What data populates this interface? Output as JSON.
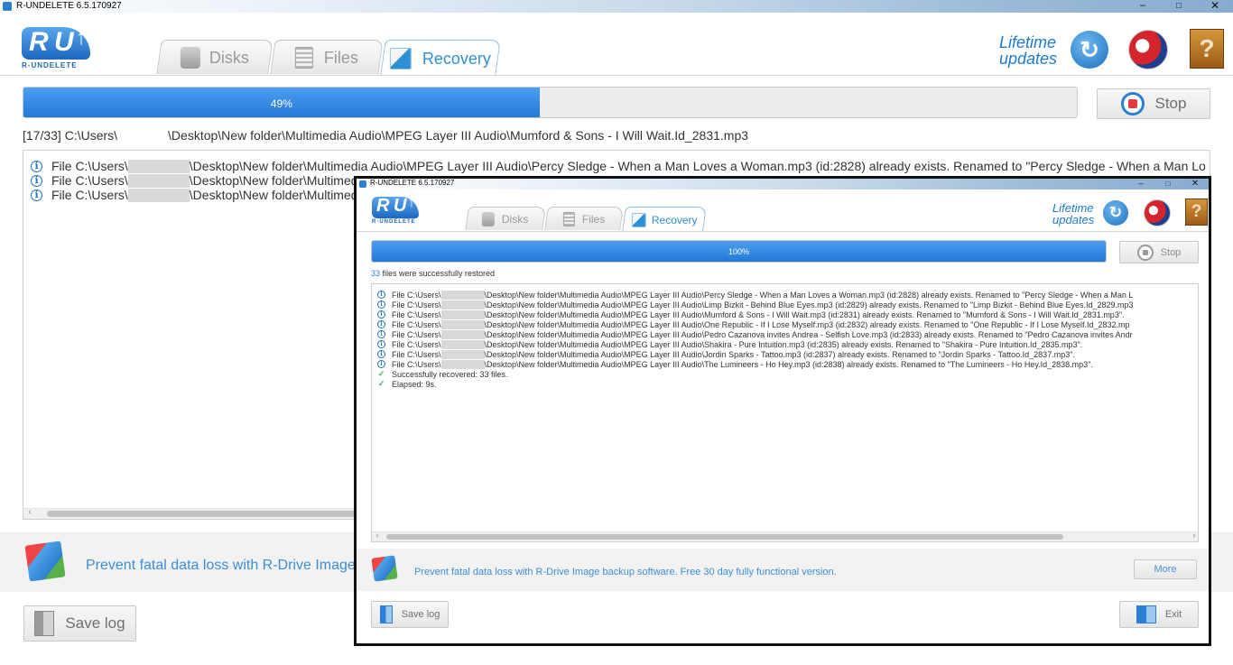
{
  "colors": {
    "accent": "#2478d9",
    "link": "#3a8fd6",
    "ok": "#4caf50",
    "stop": "#e23b3b"
  },
  "main_window": {
    "title": "R-UNDELETE 6.5.170927",
    "logo_text": "R-UNDELETE",
    "tabs": [
      {
        "label": "Disks",
        "icon": "disk-icon"
      },
      {
        "label": "Files",
        "icon": "files-icon"
      },
      {
        "label": "Recovery",
        "icon": "recovery-icon"
      }
    ],
    "lifetime_line1": "Lifetime",
    "lifetime_line2": "updates",
    "progress_percent": 49,
    "progress_label": "49%",
    "stop_label": "Stop",
    "current_file": "[17/33] C:\\Users\\    \\Desktop\\New folder\\Multimedia Audio\\MPEG Layer III Audio\\Mumford & Sons - I Will Wait.Id_2831.mp3",
    "log": [
      {
        "pre": "File C:\\Users\\",
        "post": "\\Desktop\\New folder\\Multimedia Audio\\MPEG Layer III Audio\\Percy Sledge - When a Man Loves a Woman.mp3 (id:2828) already exists. Renamed to \"Percy Sledge - When a Man Lo"
      },
      {
        "pre": "File C:\\Users\\",
        "post": "\\Desktop\\New folder\\Multimed"
      },
      {
        "pre": "File C:\\Users\\",
        "post": "\\Desktop\\New folder\\Multimed"
      }
    ],
    "promo": "Prevent fatal data loss with R-Drive Image",
    "save_log_label": "Save log"
  },
  "dialog_window": {
    "title": "R-UNDELETE 6.5.170927",
    "logo_text": "R-UNDELETE",
    "tabs": [
      {
        "label": "Disks",
        "icon": "disk-icon"
      },
      {
        "label": "Files",
        "icon": "files-icon"
      },
      {
        "label": "Recovery",
        "icon": "recovery-icon"
      }
    ],
    "lifetime_line1": "Lifetime",
    "lifetime_line2": "updates",
    "progress_percent": 100,
    "progress_label": "100%",
    "stop_label": "Stop",
    "restored_count": "33",
    "restored_text": " files were successfully restored",
    "log": [
      {
        "pre": "File C:\\Users\\",
        "post": "\\Desktop\\New folder\\Multimedia Audio\\MPEG Layer III Audio\\Percy Sledge - When a Man Loves a Woman.mp3 (id:2828) already exists. Renamed to \"Percy Sledge - When a Man L"
      },
      {
        "pre": "File C:\\Users\\",
        "post": "\\Desktop\\New folder\\Multimedia Audio\\MPEG Layer III Audio\\Limp Bizkit - Behind Blue Eyes.mp3 (id:2829) already exists. Renamed to \"Limp Bizkit - Behind Blue Eyes.Id_2829.mp3"
      },
      {
        "pre": "File C:\\Users\\",
        "post": "\\Desktop\\New folder\\Multimedia Audio\\MPEG Layer III Audio\\Mumford & Sons - I Will Wait.mp3 (id:2831) already exists. Renamed to \"Mumford & Sons - I Will Wait.Id_2831.mp3\"."
      },
      {
        "pre": "File C:\\Users\\",
        "post": "\\Desktop\\New folder\\Multimedia Audio\\MPEG Layer III Audio\\One Republic - If I Lose Myself.mp3 (id:2832) already exists. Renamed to \"One Republic - If I Lose Myself.Id_2832.mp"
      },
      {
        "pre": "File C:\\Users\\",
        "post": "\\Desktop\\New folder\\Multimedia Audio\\MPEG Layer III Audio\\Pedro Cazanova invites Andrea - Selfish Love.mp3 (id:2833) already exists. Renamed to \"Pedro Cazanova invites Andr"
      },
      {
        "pre": "File C:\\Users\\",
        "post": "\\Desktop\\New folder\\Multimedia Audio\\MPEG Layer III Audio\\Shakira - Pure Intuition.mp3 (id:2835) already exists. Renamed to \"Shakira - Pure Intuition.Id_2835.mp3\"."
      },
      {
        "pre": "File C:\\Users\\",
        "post": "\\Desktop\\New folder\\Multimedia Audio\\MPEG Layer III Audio\\Jordin Sparks - Tattoo.mp3 (id:2837) already exists. Renamed to \"Jordin Sparks - Tattoo.Id_2837.mp3\"."
      },
      {
        "pre": "File C:\\Users\\",
        "post": "\\Desktop\\New folder\\Multimedia Audio\\MPEG Layer III Audio\\The Lumineers - Ho Hey.mp3 (id:2838) already exists. Renamed to \"The Lumineers - Ho Hey.Id_2838.mp3\"."
      }
    ],
    "ok_lines": [
      "Successfully recovered: 33 files.",
      "Elapsed: 9s."
    ],
    "promo": "Prevent fatal data loss with R-Drive Image backup software. Free 30 day fully functional version.",
    "more_label": "More",
    "save_log_label": "Save log",
    "exit_label": "Exit"
  }
}
